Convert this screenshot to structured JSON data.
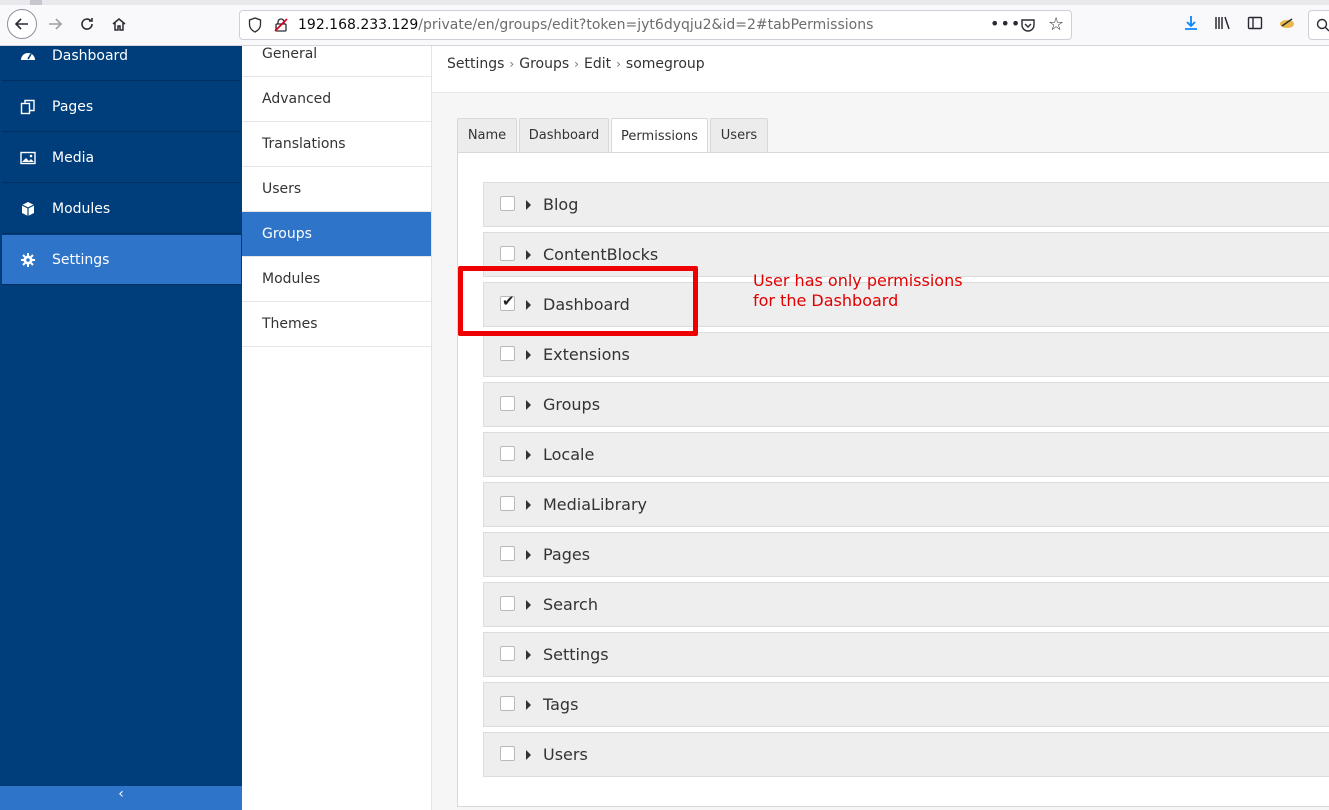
{
  "browser": {
    "url_host": "192.168.233.129",
    "url_path": "/private/en/groups/edit?token=jyt6dyqju2&id=2#tabPermissions",
    "menu_dots": "•••"
  },
  "sidebar": {
    "items": [
      {
        "label": "Dashboard",
        "icon": "dashboard-icon"
      },
      {
        "label": "Pages",
        "icon": "pages-icon"
      },
      {
        "label": "Media",
        "icon": "image-icon"
      },
      {
        "label": "Modules",
        "icon": "cube-icon"
      },
      {
        "label": "Settings",
        "icon": "gear-icon",
        "active": true
      }
    ],
    "collapse_glyph": "‹"
  },
  "subnav": {
    "items": [
      {
        "label": "General"
      },
      {
        "label": "Advanced"
      },
      {
        "label": "Translations"
      },
      {
        "label": "Users"
      },
      {
        "label": "Groups",
        "active": true
      },
      {
        "label": "Modules"
      },
      {
        "label": "Themes"
      }
    ]
  },
  "breadcrumb": [
    "Settings",
    "Groups",
    "Edit",
    "somegroup"
  ],
  "breadcrumb_separator": "›",
  "tabs": [
    {
      "label": "Name"
    },
    {
      "label": "Dashboard"
    },
    {
      "label": "Permissions",
      "active": true
    },
    {
      "label": "Users"
    }
  ],
  "permissions": [
    {
      "name": "Blog",
      "checked": false
    },
    {
      "name": "ContentBlocks",
      "checked": false
    },
    {
      "name": "Dashboard",
      "checked": true
    },
    {
      "name": "Extensions",
      "checked": false
    },
    {
      "name": "Groups",
      "checked": false
    },
    {
      "name": "Locale",
      "checked": false
    },
    {
      "name": "MediaLibrary",
      "checked": false
    },
    {
      "name": "Pages",
      "checked": false
    },
    {
      "name": "Search",
      "checked": false
    },
    {
      "name": "Settings",
      "checked": false
    },
    {
      "name": "Tags",
      "checked": false
    },
    {
      "name": "Users",
      "checked": false
    }
  ],
  "annotation": {
    "line1": "User has only permissions",
    "line2": "for the Dashboard",
    "color": "#e00000"
  },
  "colors": {
    "sidebar_bg": "#003d7b",
    "active_blue": "#2e74c8"
  }
}
